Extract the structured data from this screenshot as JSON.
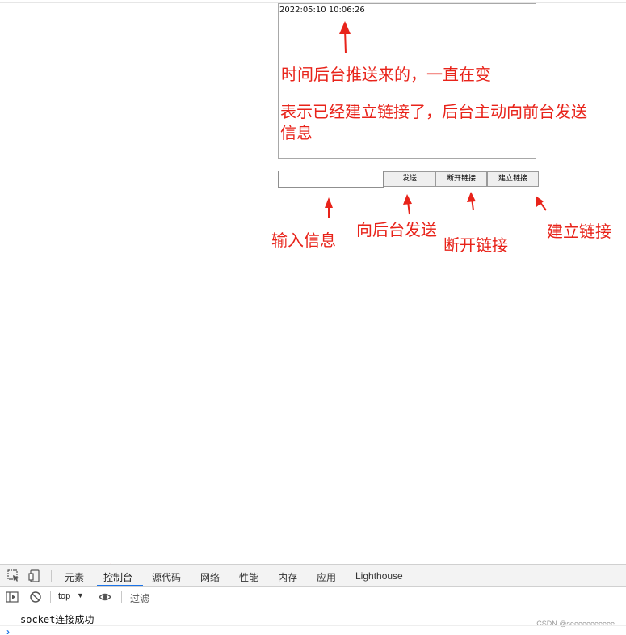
{
  "message_box": {
    "lines": [
      "2022:05:10 10:06:26"
    ]
  },
  "controls": {
    "input_value": "",
    "send_label": "发送",
    "disconnect_label": "断开链接",
    "connect_label": "建立链接"
  },
  "annotations": {
    "time_note": "时间后台推送来的，一直在变",
    "connected_note_line1": "表示已经建立链接了，后台主动向前台发送",
    "connected_note_line2": "信息",
    "input_note": "输入信息",
    "send_note": "向后台发送",
    "disconnect_note": "断开链接",
    "connect_note": "建立链接",
    "color": "#e8231a"
  },
  "devtools": {
    "tabs": [
      "元素",
      "控制台",
      "源代码",
      "网络",
      "性能",
      "内存",
      "应用",
      "Lighthouse"
    ],
    "active_tab": "控制台",
    "context": "top",
    "filter_placeholder": "过滤",
    "log": "socket连接成功",
    "prompt": "›",
    "watermark": "CSDN @seeeeeeeeeee",
    "accent": "#1a73e8"
  }
}
